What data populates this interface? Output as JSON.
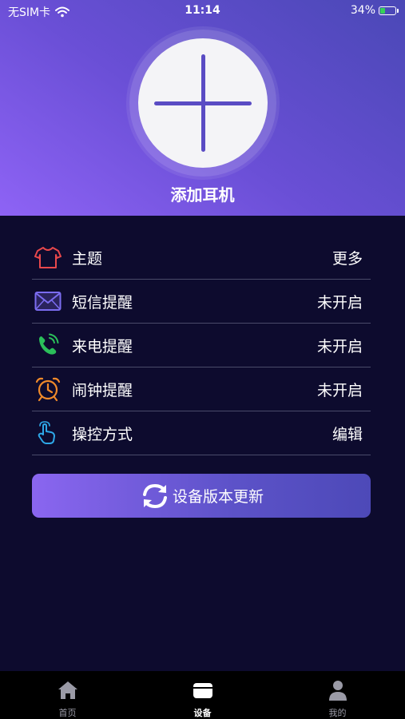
{
  "status_bar": {
    "carrier": "无SIM卡",
    "time": "11:14",
    "battery": "34%",
    "battery_level": 0.34
  },
  "header": {
    "add_title": "添加耳机"
  },
  "settings": [
    {
      "label": "主题",
      "value": "更多",
      "icon": "shirt-icon"
    },
    {
      "label": "短信提醒",
      "value": "未开启",
      "icon": "envelope-icon"
    },
    {
      "label": "来电提醒",
      "value": "未开启",
      "icon": "phone-icon"
    },
    {
      "label": "闹钟提醒",
      "value": "未开启",
      "icon": "alarm-clock-icon"
    },
    {
      "label": "操控方式",
      "value": "编辑",
      "icon": "touch-hand-icon"
    }
  ],
  "update_button": {
    "label": "设备版本更新"
  },
  "tabs": [
    {
      "label": "首页",
      "icon": "home-icon",
      "active": false
    },
    {
      "label": "设备",
      "icon": "device-icon",
      "active": true
    },
    {
      "label": "我的",
      "icon": "profile-icon",
      "active": false
    }
  ],
  "colors": {
    "background": "#0d0b2e",
    "header_gradient_start": "#8e63f5",
    "header_gradient_end": "#4a48b6",
    "accent_plus": "#5a4cc4",
    "shirt": "#e8484c",
    "envelope": "#7b6cf0",
    "phone": "#2bbf5a",
    "alarm": "#f08a2a",
    "touch": "#2ea8e8"
  }
}
